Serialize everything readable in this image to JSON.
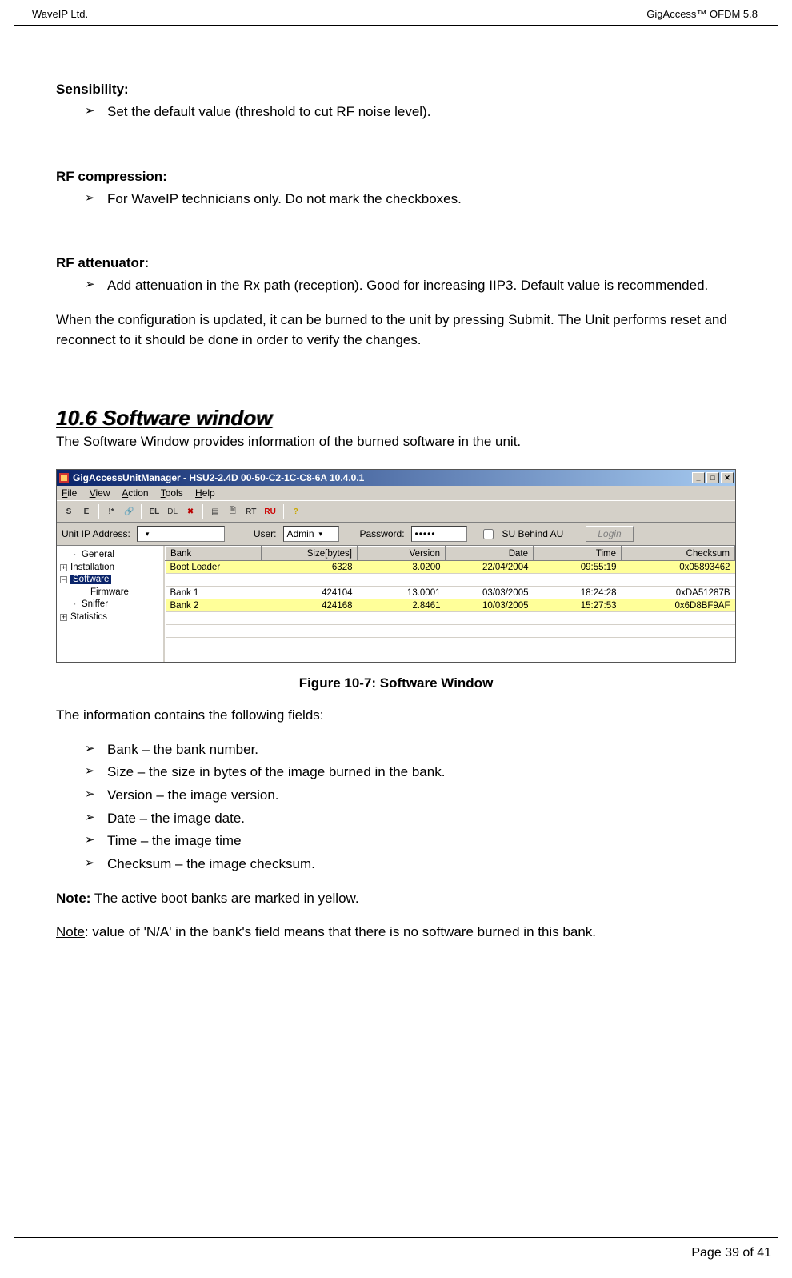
{
  "header": {
    "left": "WaveIP Ltd.",
    "right": "GigAccess™ OFDM 5.8"
  },
  "s1": {
    "title": "Sensibility:",
    "item": "Set the default value (threshold to cut RF noise level)."
  },
  "s2": {
    "title": "RF compression:",
    "item": "For WaveIP technicians only. Do not mark the checkboxes."
  },
  "s3": {
    "title": "RF attenuator:",
    "item": "Add attenuation in the Rx path (reception). Good for increasing IIP3. Default value is recommended."
  },
  "para1": "When the configuration is updated, it can be burned to the unit by pressing Submit. The Unit performs reset and reconnect to it should be done in order to verify the changes.",
  "h2": "10.6 Software window",
  "intro": "The Software Window provides information of the burned software in the unit.",
  "app": {
    "title": "GigAccessUnitManager - HSU2-2.4D 00-50-C2-1C-C8-6A  10.4.0.1",
    "menu": {
      "file": "File",
      "view": "View",
      "action": "Action",
      "tools": "Tools",
      "help": "Help"
    },
    "addr": {
      "ip_label": "Unit IP Address:",
      "user_label": "User:",
      "user_value": "Admin",
      "pass_label": "Password:",
      "pass_value": "•••••",
      "su_label": "SU Behind AU",
      "login": "Login"
    },
    "tree": {
      "n0": "General",
      "n1": "Installation",
      "n2": "Software",
      "n3": "Firmware",
      "n4": "Sniffer",
      "n5": "Statistics"
    },
    "cols": {
      "c0": "Bank",
      "c1": "Size[bytes]",
      "c2": "Version",
      "c3": "Date",
      "c4": "Time",
      "c5": "Checksum"
    },
    "rows": [
      {
        "bank": "Boot Loader",
        "size": "6328",
        "ver": "3.0200",
        "date": "22/04/2004",
        "time": "09:55:19",
        "ck": "0x05893462",
        "hl": true
      },
      {
        "bank": "",
        "size": "",
        "ver": "",
        "date": "",
        "time": "",
        "ck": "",
        "hl": false
      },
      {
        "bank": "Bank 1",
        "size": "424104",
        "ver": "13.0001",
        "date": "03/03/2005",
        "time": "18:24:28",
        "ck": "0xDA51287B",
        "hl": false
      },
      {
        "bank": "Bank 2",
        "size": "424168",
        "ver": "2.8461",
        "date": "10/03/2005",
        "time": "15:27:53",
        "ck": "0x6D8BF9AF",
        "hl": true
      },
      {
        "bank": "",
        "size": "",
        "ver": "",
        "date": "",
        "time": "",
        "ck": "",
        "hl": false
      },
      {
        "bank": "",
        "size": "",
        "ver": "",
        "date": "",
        "time": "",
        "ck": "",
        "hl": false
      }
    ]
  },
  "caption": "Figure 10-7: Software Window",
  "info_intro": "The information contains the following fields:",
  "fields": {
    "f0": "Bank – the bank number.",
    "f1": "Size – the size in bytes of the image burned in the bank.",
    "f2": "Version – the image version.",
    "f3": "Date – the image date.",
    "f4": "Time – the image time",
    "f5": "Checksum – the image checksum."
  },
  "note1_label": "Note:",
  "note1_text": " The active boot banks are marked in yellow.",
  "note2_label": "Note",
  "note2_text": ": value of 'N/A' in the bank's field means that there is no software burned in this bank.",
  "footer": "Page 39 of 41"
}
